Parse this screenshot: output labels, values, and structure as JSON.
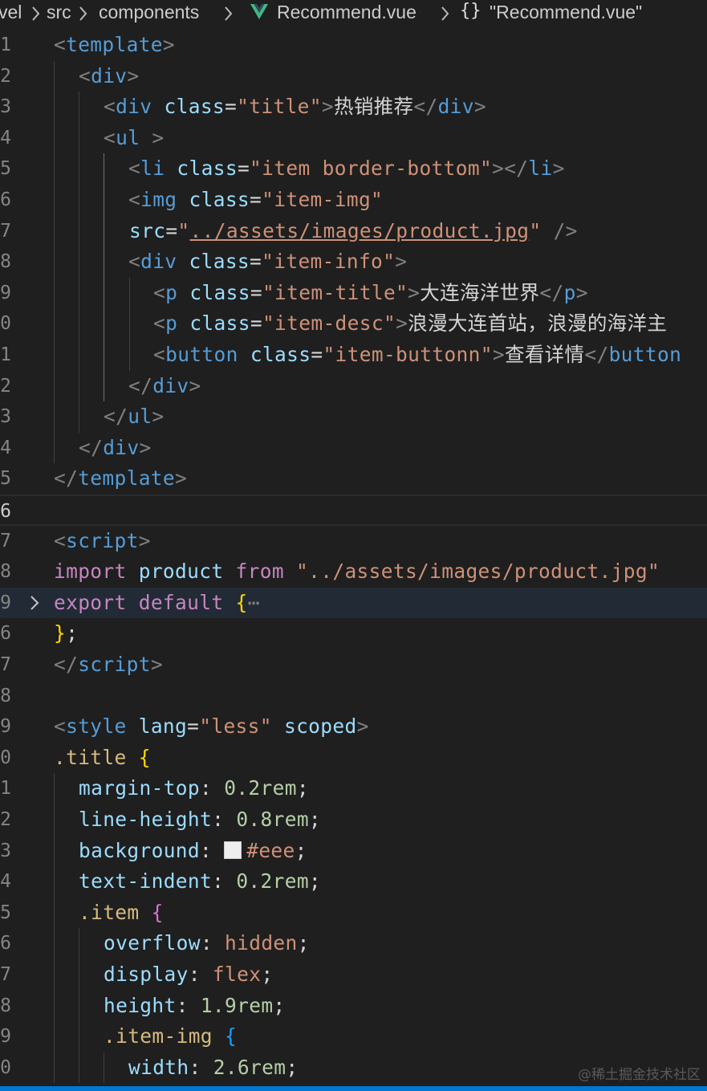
{
  "breadcrumb": {
    "items": [
      "vel",
      "src",
      "components",
      "Recommend.vue",
      "\"Recommend.vue\""
    ],
    "file_icon": "vue-icon",
    "symbol_icon": "braces-icon"
  },
  "editor": {
    "lines": [
      {
        "n": "1",
        "indent": 0,
        "tokens": [
          [
            "t-punc",
            "<"
          ],
          [
            "t-tag",
            "template"
          ],
          [
            "t-punc",
            ">"
          ]
        ]
      },
      {
        "n": "2",
        "indent": 1,
        "tokens": [
          [
            "t-punc",
            "<"
          ],
          [
            "t-tag",
            "div"
          ],
          [
            "t-punc",
            ">"
          ]
        ]
      },
      {
        "n": "3",
        "indent": 2,
        "tokens": [
          [
            "t-punc",
            "<"
          ],
          [
            "t-tag",
            "div"
          ],
          [
            "t-plain",
            " "
          ],
          [
            "t-attr",
            "class"
          ],
          [
            "t-plain",
            "="
          ],
          [
            "t-str",
            "\"title\""
          ],
          [
            "t-punc",
            ">"
          ],
          [
            "t-text cjk",
            "热销推荐"
          ],
          [
            "t-punc",
            "</"
          ],
          [
            "t-tag",
            "div"
          ],
          [
            "t-punc",
            ">"
          ]
        ]
      },
      {
        "n": "4",
        "indent": 2,
        "tokens": [
          [
            "t-punc",
            "<"
          ],
          [
            "t-tag",
            "ul"
          ],
          [
            "t-plain",
            " "
          ],
          [
            "t-punc",
            ">"
          ]
        ]
      },
      {
        "n": "5",
        "indent": 3,
        "tokens": [
          [
            "t-punc",
            "<"
          ],
          [
            "t-tag",
            "li"
          ],
          [
            "t-plain",
            " "
          ],
          [
            "t-attr",
            "class"
          ],
          [
            "t-plain",
            "="
          ],
          [
            "t-str",
            "\"item border-bottom\""
          ],
          [
            "t-punc",
            "></"
          ],
          [
            "t-tag",
            "li"
          ],
          [
            "t-punc",
            ">"
          ]
        ]
      },
      {
        "n": "6",
        "indent": 3,
        "tokens": [
          [
            "t-punc",
            "<"
          ],
          [
            "t-tag",
            "img"
          ],
          [
            "t-plain",
            " "
          ],
          [
            "t-attr",
            "class"
          ],
          [
            "t-plain",
            "="
          ],
          [
            "t-str",
            "\"item-img\""
          ]
        ]
      },
      {
        "n": "7",
        "indent": 3,
        "indentPx": 161,
        "tokens": [
          [
            "t-attr",
            "src"
          ],
          [
            "t-plain",
            "="
          ],
          [
            "t-str",
            "\""
          ],
          [
            "t-str u",
            "../assets/images/product.jpg"
          ],
          [
            "t-str",
            "\""
          ],
          [
            "t-plain",
            " "
          ],
          [
            "t-punc",
            "/>"
          ]
        ]
      },
      {
        "n": "8",
        "indent": 3,
        "tokens": [
          [
            "t-punc",
            "<"
          ],
          [
            "t-tag",
            "div"
          ],
          [
            "t-plain",
            " "
          ],
          [
            "t-attr",
            "class"
          ],
          [
            "t-plain",
            "="
          ],
          [
            "t-str",
            "\"item-info\""
          ],
          [
            "t-punc",
            ">"
          ]
        ]
      },
      {
        "n": "9",
        "indent": 4,
        "tokens": [
          [
            "t-punc",
            "<"
          ],
          [
            "t-tag",
            "p"
          ],
          [
            "t-plain",
            " "
          ],
          [
            "t-attr",
            "class"
          ],
          [
            "t-plain",
            "="
          ],
          [
            "t-str",
            "\"item-title\""
          ],
          [
            "t-punc",
            ">"
          ],
          [
            "t-text cjk",
            "大连海洋世界"
          ],
          [
            "t-punc",
            "</"
          ],
          [
            "t-tag",
            "p"
          ],
          [
            "t-punc",
            ">"
          ]
        ]
      },
      {
        "n": "0",
        "indent": 4,
        "tokens": [
          [
            "t-punc",
            "<"
          ],
          [
            "t-tag",
            "p"
          ],
          [
            "t-plain",
            " "
          ],
          [
            "t-attr",
            "class"
          ],
          [
            "t-plain",
            "="
          ],
          [
            "t-str",
            "\"item-desc\""
          ],
          [
            "t-punc",
            ">"
          ],
          [
            "t-text cjk",
            "浪漫大连首站，浪漫的海洋主"
          ]
        ]
      },
      {
        "n": "1",
        "indent": 4,
        "tokens": [
          [
            "t-punc",
            "<"
          ],
          [
            "t-tag",
            "button"
          ],
          [
            "t-plain",
            " "
          ],
          [
            "t-attr",
            "class"
          ],
          [
            "t-plain",
            "="
          ],
          [
            "t-str",
            "\"item-buttonn\""
          ],
          [
            "t-punc",
            ">"
          ],
          [
            "t-text cjk",
            "查看详情"
          ],
          [
            "t-punc",
            "</"
          ],
          [
            "t-tag",
            "button"
          ]
        ]
      },
      {
        "n": "2",
        "indent": 3,
        "tokens": [
          [
            "t-punc",
            "</"
          ],
          [
            "t-tag",
            "div"
          ],
          [
            "t-punc",
            ">"
          ]
        ]
      },
      {
        "n": "3",
        "indent": 2,
        "tokens": [
          [
            "t-punc",
            "</"
          ],
          [
            "t-tag",
            "ul"
          ],
          [
            "t-punc",
            ">"
          ]
        ]
      },
      {
        "n": "4",
        "indent": 1,
        "tokens": [
          [
            "t-punc",
            "</"
          ],
          [
            "t-tag",
            "div"
          ],
          [
            "t-punc",
            ">"
          ]
        ]
      },
      {
        "n": "5",
        "indent": 0,
        "tokens": [
          [
            "t-punc",
            "</"
          ],
          [
            "t-tag",
            "template"
          ],
          [
            "t-punc",
            ">"
          ]
        ]
      },
      {
        "n": "6",
        "indent": 0,
        "current": true,
        "tokens": []
      },
      {
        "n": "7",
        "indent": 0,
        "tokens": [
          [
            "t-punc",
            "<"
          ],
          [
            "t-tag",
            "script"
          ],
          [
            "t-punc",
            ">"
          ]
        ]
      },
      {
        "n": "8",
        "indent": 0,
        "tokens": [
          [
            "t-kw",
            "import"
          ],
          [
            "t-plain",
            " "
          ],
          [
            "t-id",
            "product"
          ],
          [
            "t-plain",
            " "
          ],
          [
            "t-kw",
            "from"
          ],
          [
            "t-plain",
            " "
          ],
          [
            "t-str",
            "\"../assets/images/product.jpg\""
          ]
        ]
      },
      {
        "n": "9",
        "indent": 0,
        "folded": true,
        "tokens": [
          [
            "t-kw",
            "export"
          ],
          [
            "t-plain",
            " "
          ],
          [
            "t-kw",
            "default"
          ],
          [
            "t-plain",
            " "
          ],
          [
            "t-b1",
            "{"
          ],
          [
            "t-ell",
            "⋯"
          ]
        ]
      },
      {
        "n": "6",
        "indent": 0,
        "tokens": [
          [
            "t-b1",
            "}"
          ],
          [
            "t-plain",
            ";"
          ]
        ]
      },
      {
        "n": "7",
        "indent": 0,
        "tokens": [
          [
            "t-punc",
            "</"
          ],
          [
            "t-tag",
            "script"
          ],
          [
            "t-punc",
            ">"
          ]
        ]
      },
      {
        "n": "8",
        "indent": 0,
        "tokens": []
      },
      {
        "n": "9",
        "indent": 0,
        "tokens": [
          [
            "t-punc",
            "<"
          ],
          [
            "t-tag",
            "style"
          ],
          [
            "t-plain",
            " "
          ],
          [
            "t-attr",
            "lang"
          ],
          [
            "t-plain",
            "="
          ],
          [
            "t-str",
            "\"less\""
          ],
          [
            "t-plain",
            " "
          ],
          [
            "t-attr",
            "scoped"
          ],
          [
            "t-punc",
            ">"
          ]
        ]
      },
      {
        "n": "0",
        "indent": 0,
        "tokens": [
          [
            "t-sel",
            ".title"
          ],
          [
            "t-plain",
            " "
          ],
          [
            "t-b1",
            "{"
          ]
        ]
      },
      {
        "n": "1",
        "indent": 1,
        "tokens": [
          [
            "t-prop",
            "margin-top"
          ],
          [
            "t-plain",
            ": "
          ],
          [
            "t-num",
            "0.2rem"
          ],
          [
            "t-plain",
            ";"
          ]
        ]
      },
      {
        "n": "2",
        "indent": 1,
        "tokens": [
          [
            "t-prop",
            "line-height"
          ],
          [
            "t-plain",
            ": "
          ],
          [
            "t-num",
            "0.8rem"
          ],
          [
            "t-plain",
            ";"
          ]
        ]
      },
      {
        "n": "3",
        "indent": 1,
        "tokens": [
          [
            "t-prop",
            "background"
          ],
          [
            "t-plain",
            ": "
          ],
          [
            "swatch",
            ""
          ],
          [
            "t-val",
            "#eee"
          ],
          [
            "t-plain",
            ";"
          ]
        ]
      },
      {
        "n": "4",
        "indent": 1,
        "tokens": [
          [
            "t-prop",
            "text-indent"
          ],
          [
            "t-plain",
            ": "
          ],
          [
            "t-num",
            "0.2rem"
          ],
          [
            "t-plain",
            ";"
          ]
        ]
      },
      {
        "n": "5",
        "indent": 1,
        "tokens": [
          [
            "t-sel",
            ".item"
          ],
          [
            "t-plain",
            " "
          ],
          [
            "t-b2",
            "{"
          ]
        ]
      },
      {
        "n": "6",
        "indent": 2,
        "tokens": [
          [
            "t-prop",
            "overflow"
          ],
          [
            "t-plain",
            ": "
          ],
          [
            "t-val",
            "hidden"
          ],
          [
            "t-plain",
            ";"
          ]
        ]
      },
      {
        "n": "7",
        "indent": 2,
        "tokens": [
          [
            "t-prop",
            "display"
          ],
          [
            "t-plain",
            ": "
          ],
          [
            "t-val",
            "flex"
          ],
          [
            "t-plain",
            ";"
          ]
        ]
      },
      {
        "n": "8",
        "indent": 2,
        "tokens": [
          [
            "t-prop",
            "height"
          ],
          [
            "t-plain",
            ": "
          ],
          [
            "t-num",
            "1.9rem"
          ],
          [
            "t-plain",
            ";"
          ]
        ]
      },
      {
        "n": "9",
        "indent": 2,
        "tokens": [
          [
            "t-sel",
            ".item-img"
          ],
          [
            "t-plain",
            " "
          ],
          [
            "t-b3",
            "{"
          ]
        ]
      },
      {
        "n": "0",
        "indent": 3,
        "tokens": [
          [
            "t-prop",
            "width"
          ],
          [
            "t-plain",
            ": "
          ],
          [
            "t-num",
            "2.6rem"
          ],
          [
            "t-plain",
            ";"
          ]
        ]
      }
    ]
  },
  "watermark": "@稀土掘金技术社区",
  "colors": {
    "background": "#1f1f1f",
    "accent": "#0078d4"
  }
}
